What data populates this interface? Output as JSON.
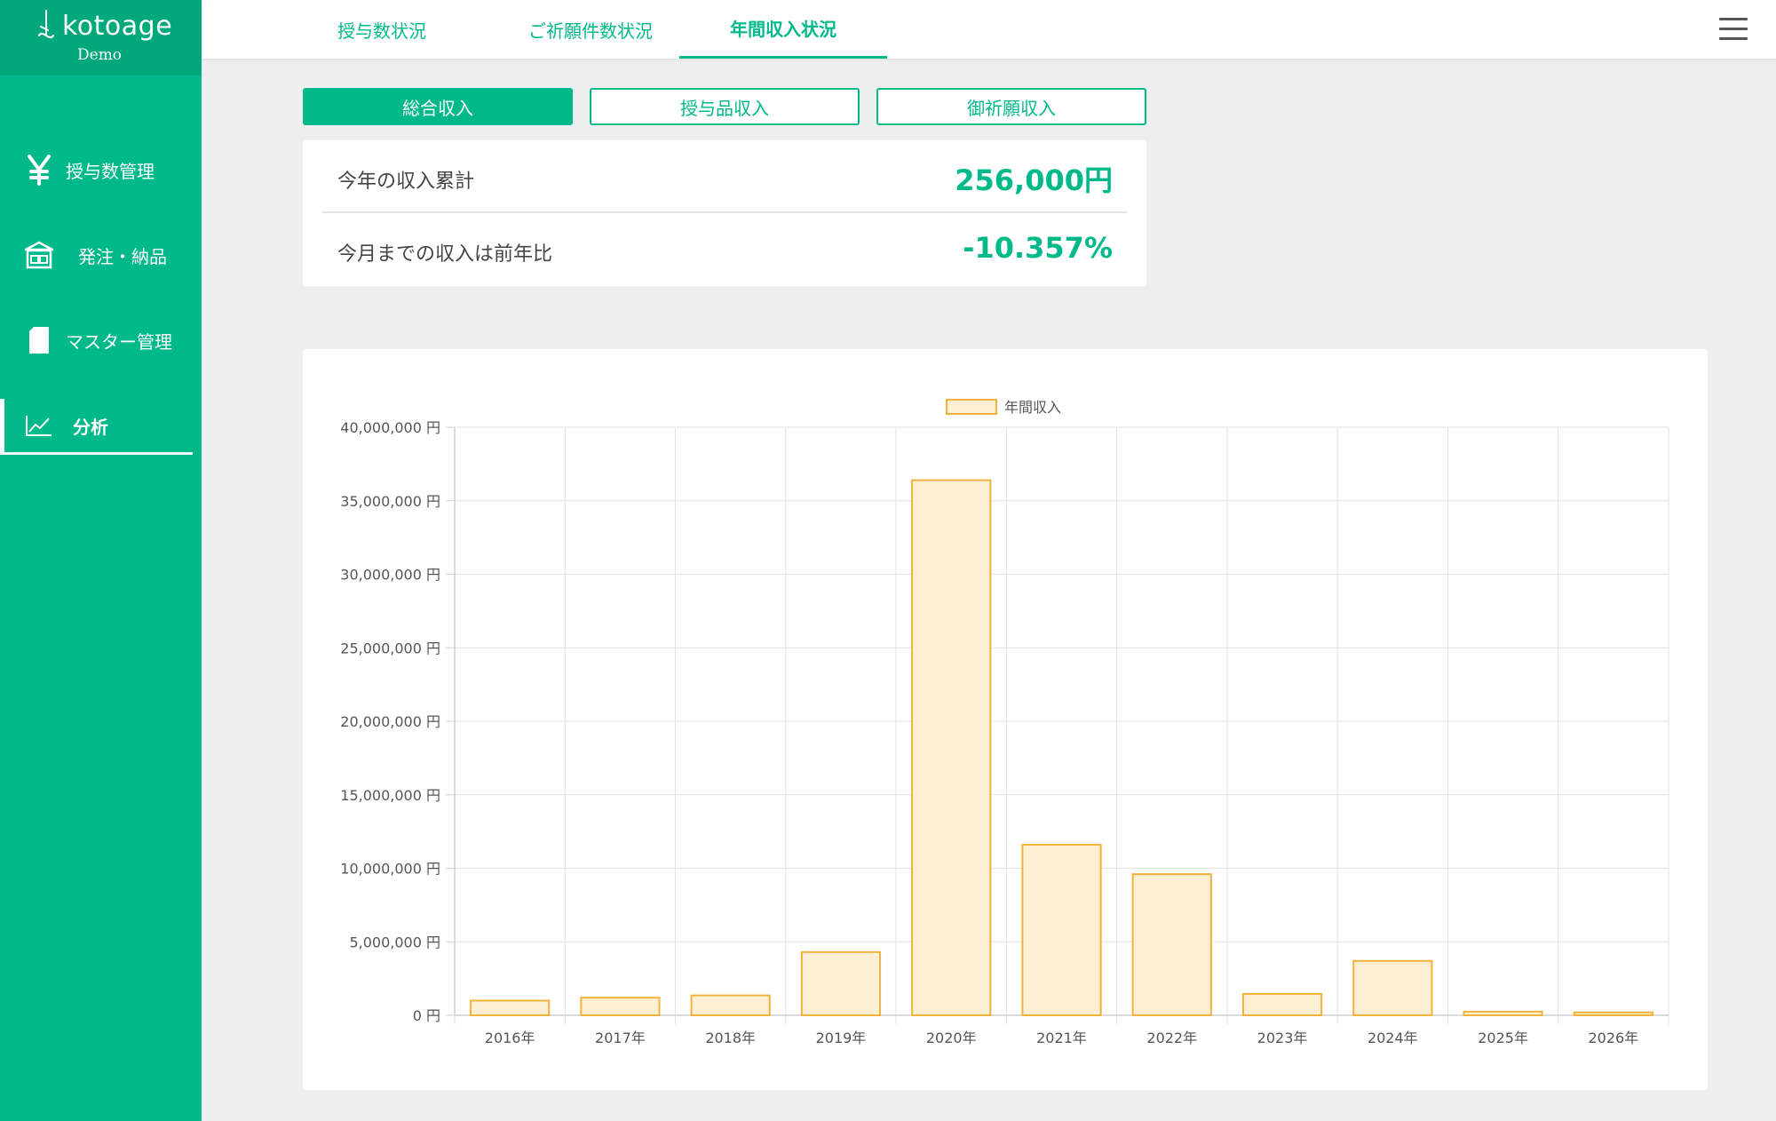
{
  "brand": {
    "name": "kotoage",
    "sub": "Demo"
  },
  "sidebar": {
    "items": [
      {
        "label": "授与数管理",
        "icon": "yen-icon"
      },
      {
        "label": "発注・納品",
        "icon": "store-icon"
      },
      {
        "label": "マスター管理",
        "icon": "document-icon"
      },
      {
        "label": "分析",
        "icon": "line-chart-icon",
        "active": true
      }
    ]
  },
  "topnav": {
    "tabs": [
      {
        "label": "授与数状況"
      },
      {
        "label": "ご祈願件数状況"
      },
      {
        "label": "年間収入状況",
        "active": true
      }
    ]
  },
  "subtabs": [
    {
      "label": "総合収入",
      "active": true
    },
    {
      "label": "授与品収入"
    },
    {
      "label": "御祈願収入"
    }
  ],
  "summary": {
    "total_label": "今年の収入累計",
    "total_value": "256,000円",
    "yoy_label": "今月までの収入は前年比",
    "yoy_value": "-10.357%"
  },
  "chart_data": {
    "type": "bar",
    "title": "",
    "legend": [
      "年間収入"
    ],
    "legend_position": "top-center",
    "grid": true,
    "categories": [
      "2016年",
      "2017年",
      "2018年",
      "2019年",
      "2020年",
      "2021年",
      "2022年",
      "2023年",
      "2024年",
      "2025年",
      "2026年"
    ],
    "series": [
      {
        "name": "年間収入",
        "values": [
          1000000,
          1200000,
          1350000,
          4300000,
          36400000,
          11600000,
          9600000,
          1450000,
          3700000,
          250000,
          200000
        ]
      }
    ],
    "ylim": [
      0,
      40000000
    ],
    "yticks": [
      0,
      5000000,
      10000000,
      15000000,
      20000000,
      25000000,
      30000000,
      35000000,
      40000000
    ],
    "ytick_labels": [
      "0 円",
      "5,000,000 円",
      "10,000,000 円",
      "15,000,000 円",
      "20,000,000 円",
      "25,000,000 円",
      "30,000,000 円",
      "35,000,000 円",
      "40,000,000 円"
    ],
    "colors": {
      "bar_fill": "#fdefd3",
      "bar_stroke": "#f2b33d"
    }
  },
  "colors": {
    "accent": "#00b98a",
    "accent_dark": "#00a87c"
  }
}
